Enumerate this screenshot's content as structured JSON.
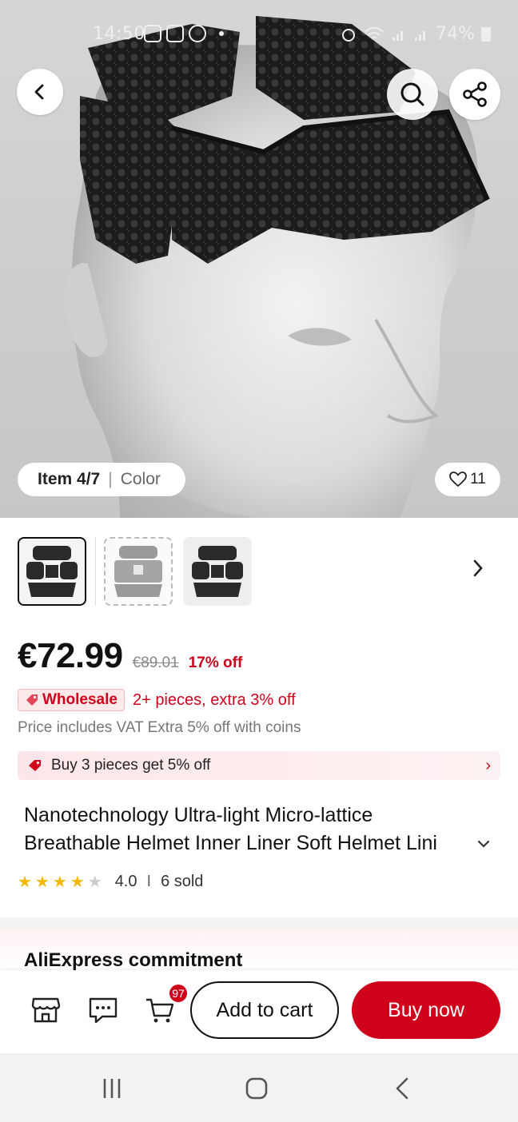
{
  "status_bar": {
    "time": "14:50",
    "battery": "74%"
  },
  "hero": {
    "item_counter": "Item 4/7",
    "variant_label": "Color",
    "like_count": "11",
    "icons": [
      "back-arrow-icon",
      "search-icon",
      "share-icon",
      "heart-icon"
    ]
  },
  "thumbnails": [
    {
      "name": "black-liner-thumbnail",
      "selected": true
    },
    {
      "name": "grey-liner-thumbnail",
      "selected": false
    },
    {
      "name": "black-liner-alt-thumbnail",
      "selected": false
    }
  ],
  "price": {
    "current": "€72.99",
    "original": "€89.01",
    "discount": "17% off"
  },
  "wholesale": {
    "badge": "Wholesale",
    "text": "2+ pieces, extra 3% off"
  },
  "vat_line": "Price includes VAT Extra 5% off with coins",
  "promo": {
    "text": "Buy 3 pieces get 5% off"
  },
  "product": {
    "title_line1": "Nanotechnology Ultra-light Micro-lattice",
    "title_line2": "Breathable Helmet Inner Liner Soft Helmet Lini",
    "rating": "4.0",
    "rating_value": 4.0,
    "sold": "6 sold"
  },
  "commitment": {
    "heading": "AliExpress commitment"
  },
  "bottom_bar": {
    "cart_count": "97",
    "add_to_cart": "Add to cart",
    "buy_now": "Buy now"
  },
  "colors": {
    "accent": "#d0021b",
    "star": "#f5b800",
    "text": "#111111"
  }
}
